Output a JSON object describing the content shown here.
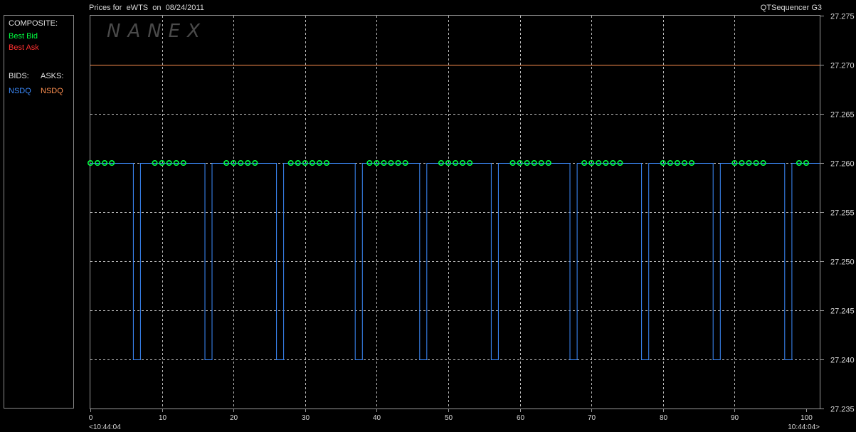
{
  "header": {
    "title": "Prices for  eWTS  on  08/24/2011",
    "app": "QTSequencer G3"
  },
  "watermark": "NANEX",
  "legend": {
    "composite_label": "COMPOSITE:",
    "best_bid": {
      "label": "Best Bid",
      "color": "#00ff40"
    },
    "best_ask": {
      "label": "Best Ask",
      "color": "#ff3030"
    },
    "bids_label": "BIDS:",
    "asks_label": "ASKS:",
    "bid_exchange": {
      "label": "NSDQ",
      "color": "#3c8cff"
    },
    "ask_exchange": {
      "label": "NSDQ",
      "color": "#ff9050"
    }
  },
  "chart_data": {
    "type": "line",
    "title": "Prices for  eWTS  on  08/24/2011",
    "x_ticks": [
      0,
      10,
      20,
      30,
      40,
      50,
      60,
      70,
      80,
      90,
      100
    ],
    "y_ticks": [
      27.235,
      27.24,
      27.245,
      27.25,
      27.255,
      27.26,
      27.265,
      27.27,
      27.275
    ],
    "xlim": [
      0,
      100
    ],
    "ylim": [
      27.235,
      27.275
    ],
    "x_start_label": "<10:44:04",
    "x_end_label": "10:44:04>",
    "grid": true,
    "series": [
      {
        "name": "NSDQ",
        "role": "bid",
        "color": "#3c8cff",
        "step": true,
        "x": [
          0,
          6,
          6,
          7,
          7,
          16,
          16,
          17,
          17,
          26,
          26,
          27,
          27,
          37,
          37,
          38,
          38,
          46,
          46,
          47,
          47,
          56,
          56,
          57,
          57,
          67,
          67,
          68,
          68,
          77,
          77,
          78,
          78,
          87,
          87,
          88,
          88,
          97,
          97,
          98,
          98,
          100
        ],
        "y": [
          27.26,
          27.26,
          27.24,
          27.24,
          27.26,
          27.26,
          27.24,
          27.24,
          27.26,
          27.26,
          27.24,
          27.24,
          27.26,
          27.26,
          27.24,
          27.24,
          27.26,
          27.26,
          27.24,
          27.24,
          27.26,
          27.26,
          27.24,
          27.24,
          27.26,
          27.26,
          27.24,
          27.24,
          27.26,
          27.26,
          27.24,
          27.24,
          27.26,
          27.26,
          27.24,
          27.24,
          27.26,
          27.26,
          27.24,
          27.24,
          27.26,
          27.26
        ]
      },
      {
        "name": "NSDQ",
        "role": "ask",
        "color": "#ff9050",
        "x": [
          0,
          100
        ],
        "y": [
          27.27,
          27.27
        ]
      },
      {
        "name": "Best Bid",
        "role": "best-bid-markers",
        "color": "#00ff40",
        "x": [
          0,
          1,
          2,
          3,
          9,
          10,
          11,
          12,
          13,
          19,
          20,
          21,
          22,
          23,
          28,
          29,
          30,
          31,
          32,
          33,
          39,
          40,
          41,
          42,
          43,
          44,
          49,
          50,
          51,
          52,
          53,
          59,
          60,
          61,
          62,
          63,
          64,
          69,
          70,
          71,
          72,
          73,
          74,
          80,
          81,
          82,
          83,
          84,
          90,
          91,
          92,
          93,
          94,
          99,
          100
        ],
        "y": 27.26
      }
    ]
  }
}
